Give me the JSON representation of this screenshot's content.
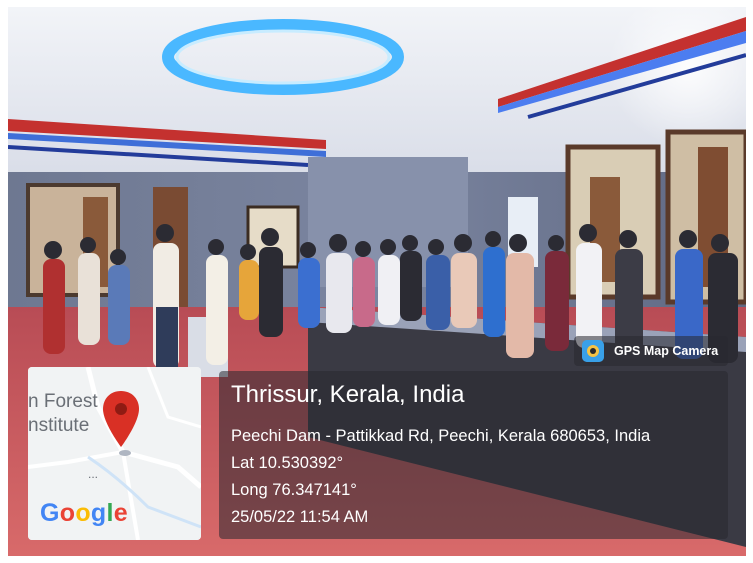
{
  "photo": {
    "subject": "group-of-visitors-in-museum-gallery",
    "colors": {
      "ceiling_light": "#4ab8ff",
      "red_trim": "#c4312f",
      "floor": "#c95a5a"
    }
  },
  "map_thumbnail": {
    "place_label_line1": "n Forest",
    "place_label_line2": "nstitute",
    "more_indicator": "...",
    "pin_icon": "map-pin-icon",
    "pin_color": "#d93025",
    "google_logo": {
      "letters": [
        "G",
        "o",
        "o",
        "g",
        "l",
        "e"
      ],
      "colors": [
        "#4285f4",
        "#ea4335",
        "#fbbc05",
        "#4285f4",
        "#34a853",
        "#ea4335"
      ]
    }
  },
  "badge": {
    "app_name": "GPS Map Camera",
    "icon": "gps-map-camera-app-icon"
  },
  "location": {
    "title": "Thrissur, Kerala, India",
    "address": "Peechi Dam - Pattikkad Rd, Peechi, Kerala 680653, India",
    "latitude": "Lat 10.530392°",
    "longitude": "Long 76.347141°",
    "timestamp": "25/05/22 11:54 AM"
  }
}
